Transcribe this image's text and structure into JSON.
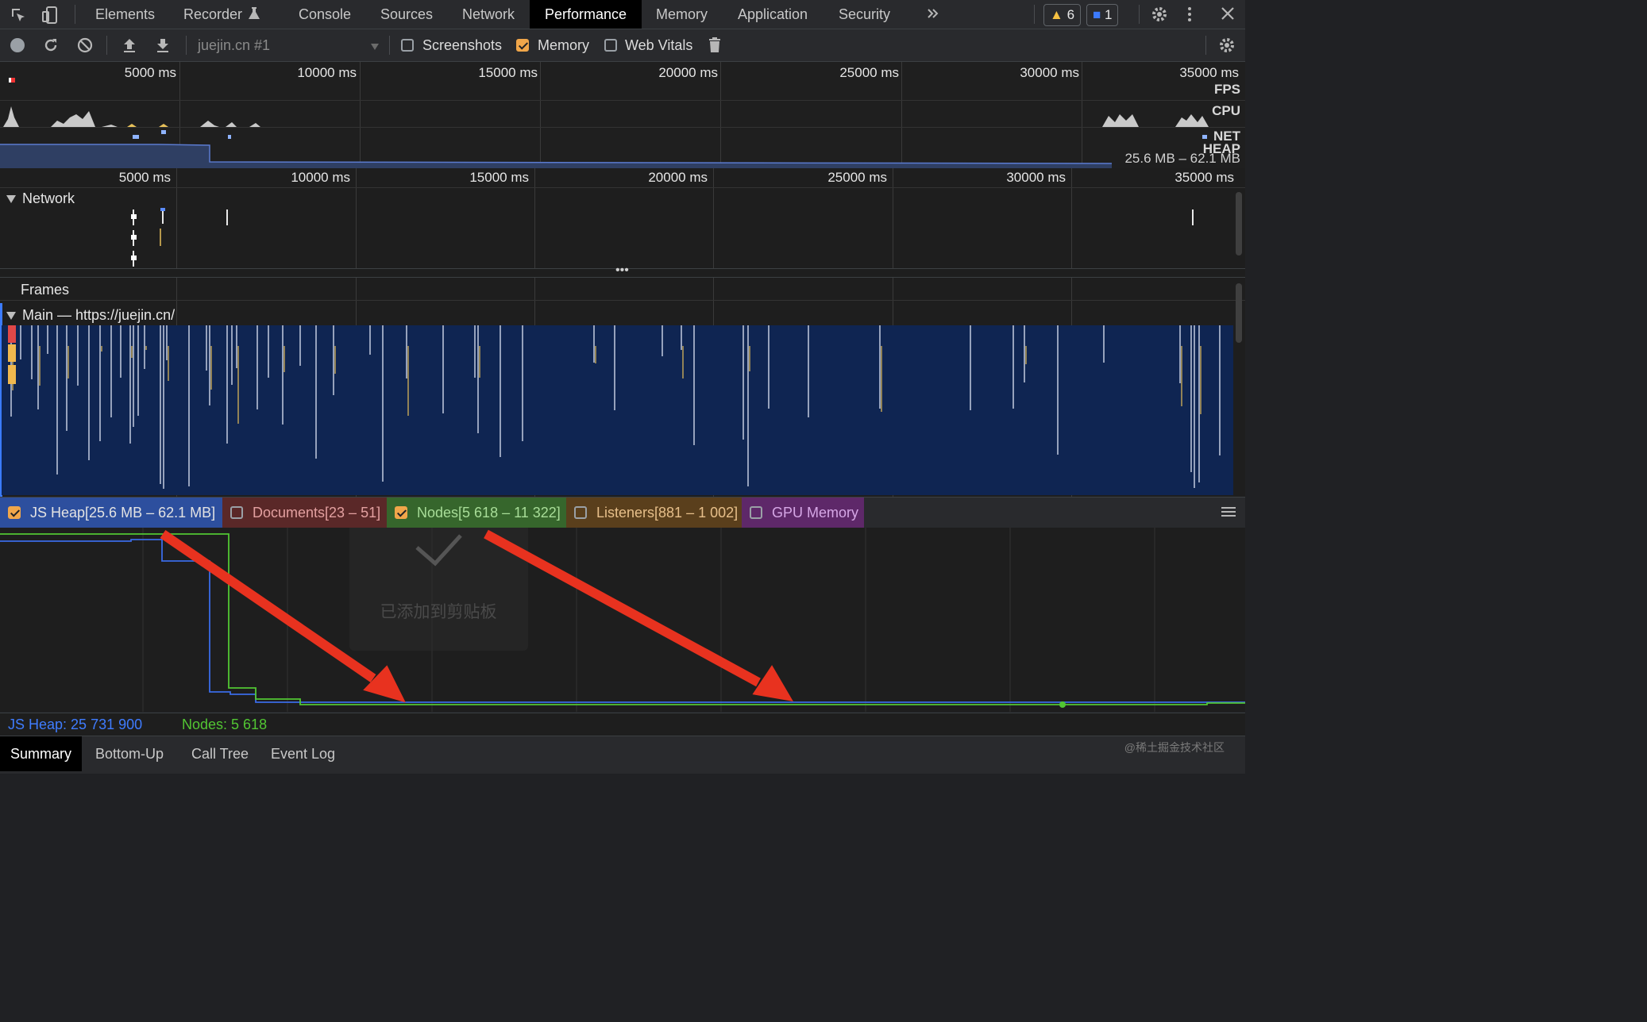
{
  "tabbar": {
    "tabs": [
      {
        "label": "Elements",
        "active": false
      },
      {
        "label": "Recorder",
        "active": false
      },
      {
        "label": "Console",
        "active": false
      },
      {
        "label": "Sources",
        "active": false
      },
      {
        "label": "Network",
        "active": false
      },
      {
        "label": "Performance",
        "active": true
      },
      {
        "label": "Memory",
        "active": false
      },
      {
        "label": "Application",
        "active": false
      },
      {
        "label": "Security",
        "active": false
      }
    ],
    "more_icon": "double-chevron-right-icon",
    "warnings_count": "6",
    "messages_count": "1"
  },
  "toolbar": {
    "target": "juejin.cn #1",
    "screenshots_label": "Screenshots",
    "screenshots_checked": false,
    "memory_label": "Memory",
    "memory_checked": true,
    "webvitals_label": "Web Vitals",
    "webvitals_checked": false
  },
  "overview": {
    "ticks": [
      "5000 ms",
      "10000 ms",
      "15000 ms",
      "20000 ms",
      "25000 ms",
      "30000 ms",
      "35000 ms"
    ],
    "fps_label": "FPS",
    "cpu_label": "CPU",
    "net_label": "NET",
    "heap_label": "HEAP",
    "heap_range": "25.6 MB – 62.1 MB"
  },
  "timeline": {
    "ticks": [
      "5000 ms",
      "10000 ms",
      "15000 ms",
      "20000 ms",
      "25000 ms",
      "30000 ms",
      "35000 ms"
    ],
    "network_label": "Network",
    "frames_label": "Frames",
    "main_label": "Main — https://juejin.cn/"
  },
  "counters": {
    "js_heap": {
      "label": "JS Heap[25.6 MB – 62.1 MB]",
      "checked": true,
      "color": "#2f5fd6"
    },
    "documents": {
      "label": "Documents[23 – 51]",
      "checked": false,
      "color": "#c94141"
    },
    "nodes": {
      "label": "Nodes[5 618 – 11 322]",
      "checked": true,
      "color": "#49b82c"
    },
    "listeners": {
      "label": "Listeners[881 – 1 002]",
      "checked": false,
      "color": "#d18a1f"
    },
    "gpu": {
      "label": "GPU Memory",
      "checked": false,
      "color": "#9b3ab4"
    },
    "js_heap_readout": "JS Heap: 25 731 900",
    "nodes_readout": "Nodes: 5 618",
    "toast": "已添加到剪贴板"
  },
  "bottom_tabs": [
    {
      "label": "Summary",
      "active": true
    },
    {
      "label": "Bottom-Up",
      "active": false
    },
    {
      "label": "Call Tree",
      "active": false
    },
    {
      "label": "Event Log",
      "active": false
    }
  ],
  "watermark": "@稀土掘金技术社区"
}
